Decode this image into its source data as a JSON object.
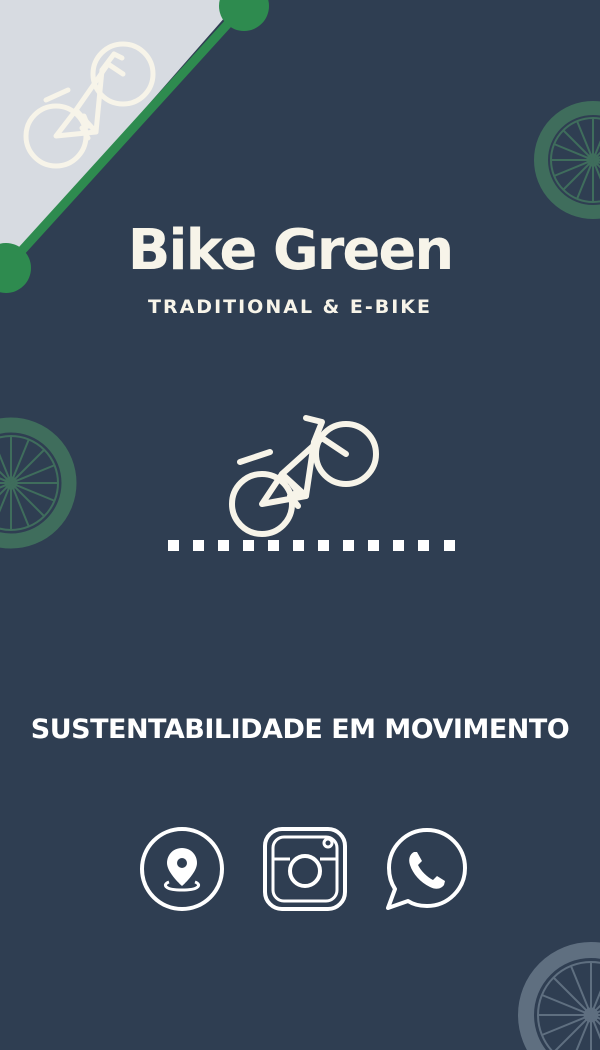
{
  "brand": {
    "title": "Bike Green",
    "subtitle": "TRADITIONAL & E-BIKE"
  },
  "tagline": "SUSTENTABILIDADE EM MOVIMENTO",
  "icons": {
    "hero": "e-bike-icon",
    "corner": "bicycle-icon",
    "wheels": "bike-wheel-icon",
    "social": [
      "location-pin-icon",
      "instagram-icon",
      "whatsapp-icon"
    ]
  },
  "colors": {
    "background": "#2f3e52",
    "accent": "#2e8b4f",
    "text": "#f7f4e9",
    "corner_panel": "#d7dbe1"
  }
}
